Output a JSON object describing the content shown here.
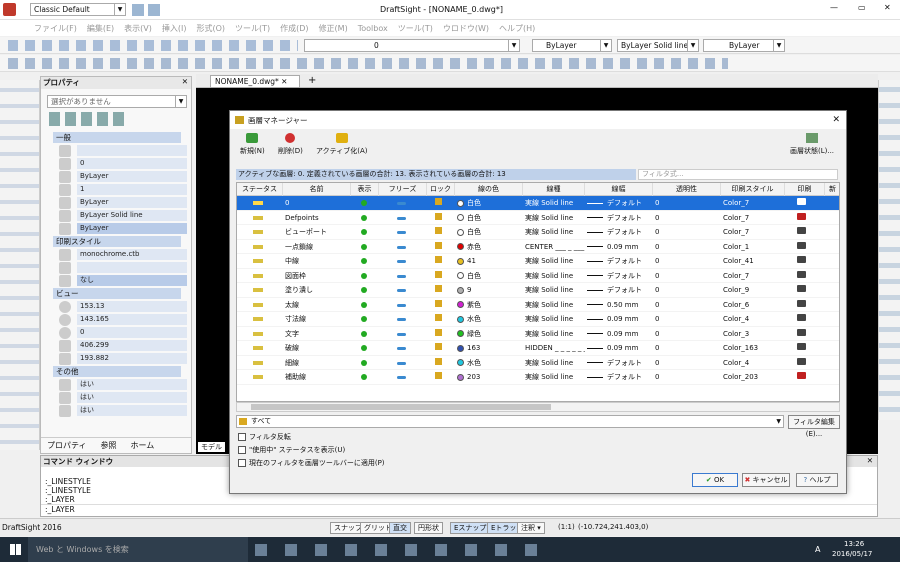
{
  "app": {
    "title": "DraftSight - [NONAME_0.dwg*]",
    "workspace": "Classic Default",
    "status_app": "DraftSight 2016"
  },
  "menu": [
    "ファイル(F)",
    "編集(E)",
    "表示(V)",
    "挿入(I)",
    "形式(O)",
    "ツール(T)",
    "作成(D)",
    "修正(M)",
    "Toolbox",
    "ツール(T)",
    "ウロドウ(W)",
    "ヘルプ(H)"
  ],
  "layer_toolbar": {
    "current_layer": "0",
    "color": "ByLayer",
    "linetype": "ByLayer    Solid line",
    "lineweight": "ByLayer"
  },
  "properties": {
    "title": "プロパティ",
    "selection": "選択がありません",
    "sections": {
      "general": "一般",
      "print": "印刷スタイル",
      "view": "ビュー",
      "other": "その他"
    },
    "general_values": [
      "",
      "0",
      "ByLayer",
      "1",
      "ByLayer",
      "ByLayer    Solid line",
      "ByLayer"
    ],
    "print_values": [
      "monochrome.ctb",
      "",
      "なし"
    ],
    "view_values": [
      "153.13",
      "143.165",
      "0",
      "406.299",
      "193.882"
    ],
    "other_values": [
      "はい",
      "はい",
      "はい"
    ],
    "tabs": [
      "プロパティ",
      "参照",
      "ホーム"
    ]
  },
  "doc_tab": "NONAME_0.dwg*",
  "model_tab": "モデル",
  "command": {
    "title": "コマンド ウィンドウ",
    "lines": [
      ":_LINESTYLE",
      ":_LINESTYLE",
      ":_LAYER",
      ":_LAYER"
    ]
  },
  "status": {
    "buttons": [
      "スナップ",
      "グリッド",
      "直交",
      "円形状",
      "Eスナップ",
      "Eトラック"
    ],
    "annotation": "注釈",
    "scale": "(1:1)",
    "coords": "(-10.724,241.403,0)"
  },
  "taskbar": {
    "search": "Web と Windows を検索",
    "time": "13:26",
    "date": "2016/05/17",
    "ime": "A"
  },
  "dialog": {
    "title": "画層マネージャー",
    "new": "新規(N)",
    "delete": "削除(D)",
    "activate": "アクティブ化(A)",
    "states": "画層状態(L)...",
    "info": "アクティブな画層: 0. 定義されている画層の合計: 13. 表示されている画層の合計: 13",
    "filter_placeholder": "フィルタ式...",
    "columns": [
      "ステータス",
      "名前",
      "表示",
      "フリーズ",
      "ロック",
      "線の色",
      "線種",
      "線幅",
      "透明性",
      "印刷スタイル",
      "印刷",
      "新"
    ],
    "layers": [
      {
        "name": "0",
        "color": "白色",
        "swatch": "#ffffff",
        "ltype": "実線  Solid line",
        "lw": "デフォルト",
        "tr": "0",
        "ps": "Color_7",
        "print_off": false
      },
      {
        "name": "Defpoints",
        "color": "白色",
        "swatch": "#ffffff",
        "ltype": "実線  Solid line",
        "lw": "デフォルト",
        "tr": "0",
        "ps": "Color_7",
        "print_off": true
      },
      {
        "name": "ビューポート",
        "color": "白色",
        "swatch": "#ffffff",
        "ltype": "実線  Solid line",
        "lw": "デフォルト",
        "tr": "0",
        "ps": "Color_7",
        "print_off": false
      },
      {
        "name": "一点鎖線",
        "color": "赤色",
        "swatch": "#e00000",
        "ltype": "CENTER  ___ _ ___",
        "lw": "0.09 mm",
        "tr": "0",
        "ps": "Color_1",
        "print_off": false
      },
      {
        "name": "中線",
        "color": "41",
        "swatch": "#e8c020",
        "ltype": "実線  Solid line",
        "lw": "デフォルト",
        "tr": "0",
        "ps": "Color_41",
        "print_off": false
      },
      {
        "name": "図面枠",
        "color": "白色",
        "swatch": "#ffffff",
        "ltype": "実線  Solid line",
        "lw": "デフォルト",
        "tr": "0",
        "ps": "Color_7",
        "print_off": false
      },
      {
        "name": "塗り潰し",
        "color": "9",
        "swatch": "#b0b0b0",
        "ltype": "実線  Solid line",
        "lw": "デフォルト",
        "tr": "0",
        "ps": "Color_9",
        "print_off": false
      },
      {
        "name": "太線",
        "color": "紫色",
        "swatch": "#d020d0",
        "ltype": "実線  Solid line",
        "lw": "0.50 mm",
        "tr": "0",
        "ps": "Color_6",
        "print_off": false
      },
      {
        "name": "寸法線",
        "color": "水色",
        "swatch": "#20c8e0",
        "ltype": "実線  Solid line",
        "lw": "0.09 mm",
        "tr": "0",
        "ps": "Color_4",
        "print_off": false
      },
      {
        "name": "文字",
        "color": "緑色",
        "swatch": "#20c020",
        "ltype": "実線  Solid line",
        "lw": "0.09 mm",
        "tr": "0",
        "ps": "Color_3",
        "print_off": false
      },
      {
        "name": "破線",
        "color": "163",
        "swatch": "#3050b0",
        "ltype": "HIDDEN  _ _ _ _ _ _",
        "lw": "0.09 mm",
        "tr": "0",
        "ps": "Color_163",
        "print_off": false
      },
      {
        "name": "細線",
        "color": "水色",
        "swatch": "#20c8e0",
        "ltype": "実線  Solid line",
        "lw": "デフォルト",
        "tr": "0",
        "ps": "Color_4",
        "print_off": false
      },
      {
        "name": "補助線",
        "color": "203",
        "swatch": "#b070d0",
        "ltype": "実線  Solid line",
        "lw": "デフォルト",
        "tr": "0",
        "ps": "Color_203",
        "print_off": true
      }
    ],
    "filter": "すべて",
    "filter_edit": "フィルタ編集(E)...",
    "checks": [
      "フィルタ反転",
      "\"使用中\" ステータスを表示(U)",
      "現在のフィルタを画層ツールバーに適用(P)"
    ],
    "ok": "OK",
    "cancel": "キャンセル",
    "help": "ヘルプ"
  }
}
